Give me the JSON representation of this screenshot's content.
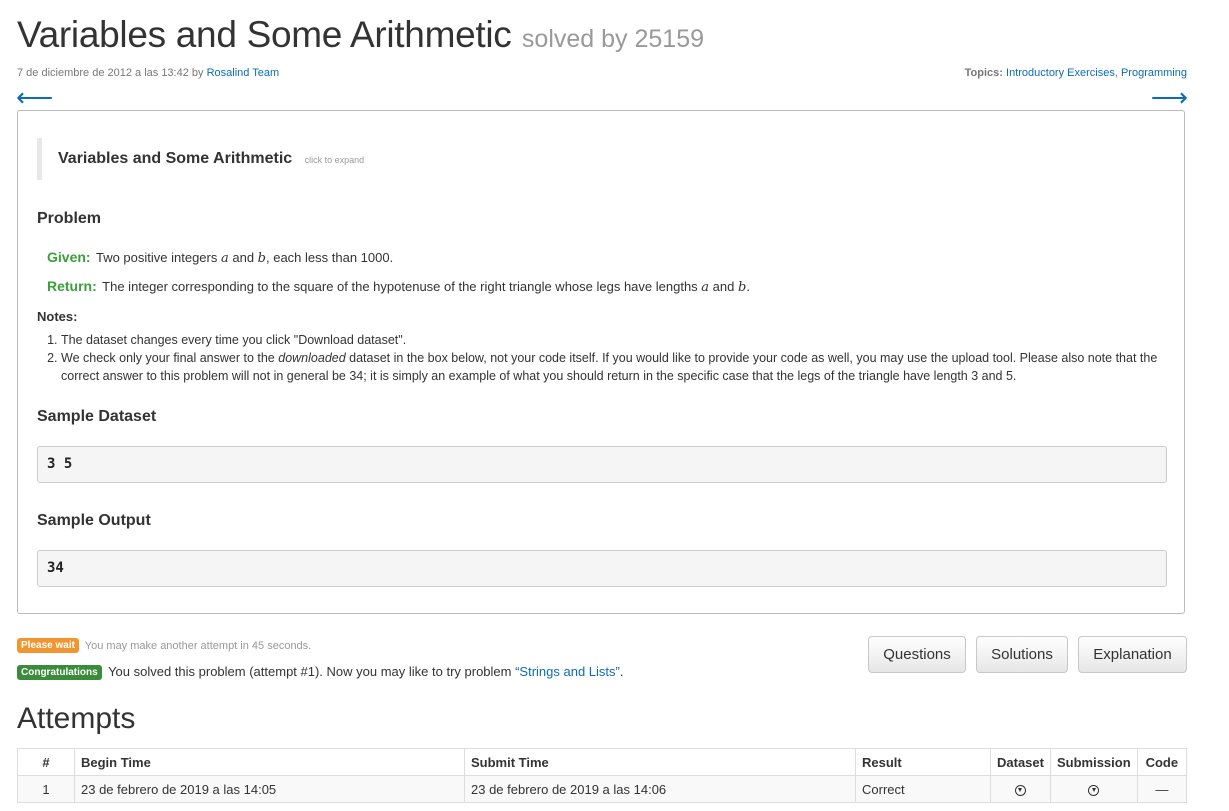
{
  "header": {
    "title": "Variables and Some Arithmetic",
    "solved_by": "solved by 25159",
    "date": "7 de diciembre de 2012 a las 13:42",
    "by": "by",
    "author": "Rosalind Team",
    "topics_label": "Topics:",
    "topics": [
      "Introductory Exercises",
      "Programming"
    ],
    "prev_arrow": "⟵",
    "next_arrow": "⟶"
  },
  "problem": {
    "expand_title": "Variables and Some Arithmetic",
    "expand_hint": "click to expand",
    "problem_heading": "Problem",
    "given_label": "Given:",
    "given_text_1": "Two positive integers ",
    "given_var_a": "a",
    "given_text_2": " and ",
    "given_var_b": "b",
    "given_text_3": ", each less than 1000.",
    "return_label": "Return:",
    "return_text_1": "The integer corresponding to the square of the hypotenuse of the right triangle whose legs have lengths ",
    "return_var_a": "a",
    "return_text_2": " and ",
    "return_var_b": "b",
    "return_text_3": ".",
    "notes_label": "Notes:",
    "note1": "The dataset changes every time you click \"Download dataset\".",
    "note2_pre": "We check only your final answer to the ",
    "note2_em": "downloaded",
    "note2_post": " dataset in the box below, not your code itself. If you would like to provide your code as well, you may use the upload tool. Please also note that the correct answer to this problem will not in general be 34; it is simply an example of what you should return in the specific case that the legs of the triangle have length 3 and 5.",
    "sample_dataset_heading": "Sample Dataset",
    "sample_dataset": "3 5",
    "sample_output_heading": "Sample Output",
    "sample_output": "34"
  },
  "status": {
    "wait_badge": "Please wait",
    "wait_text": "You may make another attempt in 45 seconds.",
    "congrats_badge": "Congratulations",
    "congrats_text": "You solved this problem (attempt #1). Now you may like to try problem ",
    "next_problem": "“Strings and Lists”",
    "congrats_end": "."
  },
  "buttons": {
    "questions": "Questions",
    "solutions": "Solutions",
    "explanation": "Explanation"
  },
  "attempts": {
    "heading": "Attempts",
    "columns": [
      "#",
      "Begin Time",
      "Submit Time",
      "Result",
      "Dataset",
      "Submission",
      "Code"
    ],
    "rows": [
      {
        "num": "1",
        "begin": "23 de febrero de 2019 a las 14:05",
        "submit": "23 de febrero de 2019 a las 14:06",
        "result": "Correct",
        "dataset_icon": "download-icon",
        "submission_icon": "download-icon",
        "code": "—"
      }
    ]
  }
}
